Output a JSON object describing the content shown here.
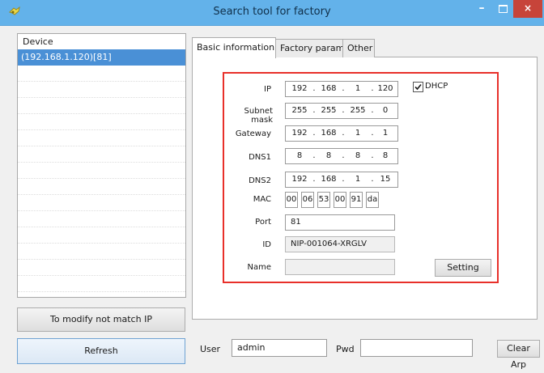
{
  "window": {
    "title": "Search tool for factory",
    "close_symbol": "×",
    "minimize_symbol": "–"
  },
  "device_list": {
    "header": "Device",
    "items": [
      "(192.168.1.120)[81]"
    ]
  },
  "buttons": {
    "modify": "To modify not match IP",
    "refresh": "Refresh",
    "setting": "Setting",
    "clear_arp": "Clear Arp"
  },
  "tabs": [
    {
      "label": "Basic information",
      "active": true
    },
    {
      "label": "Factory param",
      "active": false
    },
    {
      "label": "Other",
      "active": false
    }
  ],
  "form": {
    "ip": {
      "label": "IP",
      "octets": [
        "192",
        "168",
        "1",
        "120"
      ]
    },
    "subnet": {
      "label": "Subnet mask",
      "octets": [
        "255",
        "255",
        "255",
        "0"
      ]
    },
    "gateway": {
      "label": "Gateway",
      "octets": [
        "192",
        "168",
        "1",
        "1"
      ]
    },
    "dns1": {
      "label": "DNS1",
      "octets": [
        "8",
        "8",
        "8",
        "8"
      ]
    },
    "dns2": {
      "label": "DNS2",
      "octets": [
        "192",
        "168",
        "1",
        "15"
      ]
    },
    "mac": {
      "label": "MAC",
      "bytes": [
        "00",
        "06",
        "53",
        "00",
        "91",
        "da"
      ]
    },
    "port": {
      "label": "Port",
      "value": "81"
    },
    "id": {
      "label": "ID",
      "value": "NIP-001064-XRGLV"
    },
    "name": {
      "label": "Name",
      "value": ""
    },
    "dhcp": {
      "label": "DHCP",
      "checked": true
    }
  },
  "bottom": {
    "user_label": "User",
    "user_value": "admin",
    "pwd_label": "Pwd",
    "pwd_value": ""
  },
  "colors": {
    "title_bar": "#63b2ea",
    "selection": "#4a90d6",
    "highlight_box": "#e8302a",
    "close_button": "#c7443a"
  }
}
